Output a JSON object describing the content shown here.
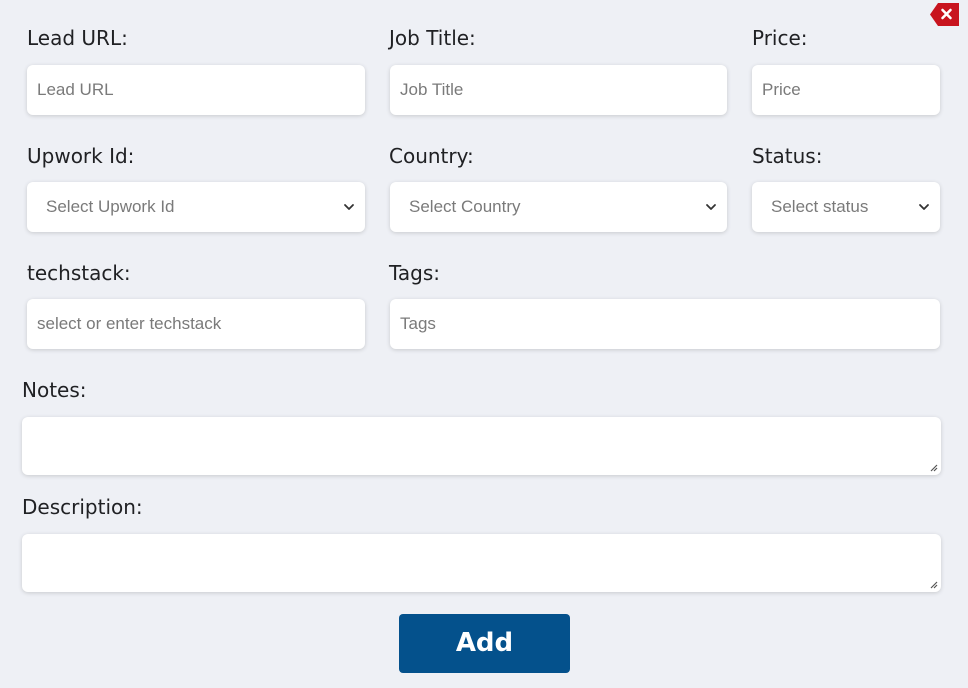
{
  "form": {
    "lead_url": {
      "label": "Lead URL:",
      "placeholder": "Lead URL",
      "value": ""
    },
    "job_title": {
      "label": "Job Title:",
      "placeholder": "Job Title",
      "value": ""
    },
    "price": {
      "label": "Price:",
      "placeholder": "Price",
      "value": ""
    },
    "upwork_id": {
      "label": "Upwork Id:",
      "selected": "Select Upwork Id"
    },
    "country": {
      "label": "Country:",
      "selected": "Select Country"
    },
    "status": {
      "label": "Status:",
      "selected": "Select status"
    },
    "techstack": {
      "label": "techstack:",
      "placeholder": "select or enter techstack",
      "value": ""
    },
    "tags": {
      "label": "Tags:",
      "placeholder": "Tags",
      "value": ""
    },
    "notes": {
      "label": "Notes:",
      "value": ""
    },
    "description": {
      "label": "Description:",
      "value": ""
    },
    "add_button": {
      "label": "Add"
    }
  },
  "icons": {
    "close": "close-icon",
    "dropdown": "chevron-down-icon",
    "resize": "resize-grip-icon"
  },
  "colors": {
    "background": "#eef0f5",
    "primary_button": "#04518c",
    "close_button": "#c8141e",
    "placeholder": "#7a7a7a"
  }
}
